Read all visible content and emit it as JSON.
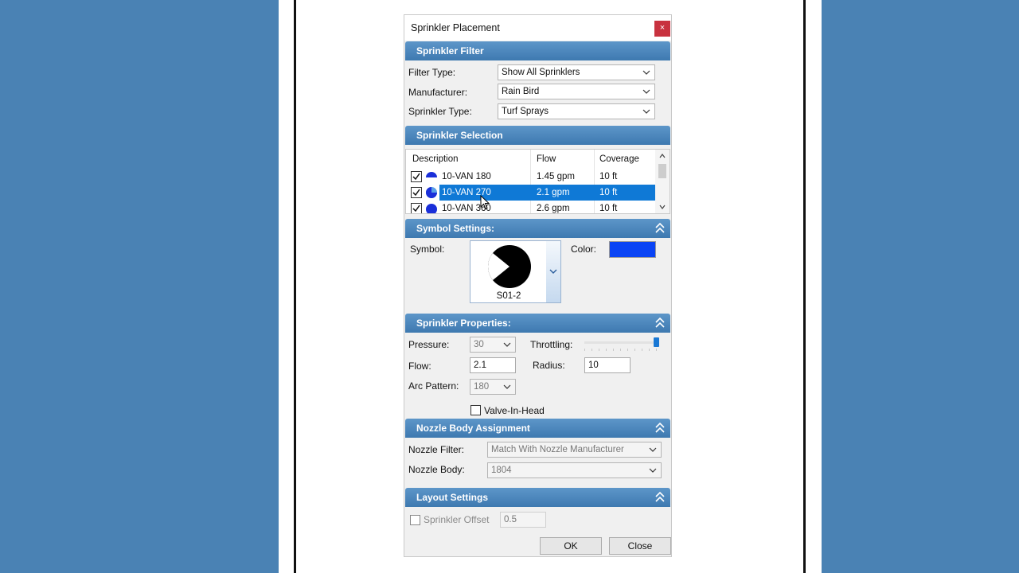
{
  "dialog": {
    "title": "Sprinkler Placement",
    "close_glyph": "×"
  },
  "filter_section": {
    "header": "Sprinkler Filter",
    "filter_type_label": "Filter Type:",
    "filter_type_value": "Show All Sprinklers",
    "manufacturer_label": "Manufacturer:",
    "manufacturer_value": "Rain Bird",
    "sprinkler_type_label": "Sprinkler Type:",
    "sprinkler_type_value": "Turf Sprays"
  },
  "selection_section": {
    "header": "Sprinkler Selection",
    "columns": [
      "Description",
      "Flow",
      "Coverage"
    ],
    "rows": [
      {
        "description": "10-VAN 180",
        "flow": "1.45 gpm",
        "coverage": "10 ft",
        "checked": true,
        "icon": "half-circle-icon",
        "selected": false
      },
      {
        "description": "10-VAN 270",
        "flow": "2.1 gpm",
        "coverage": "10 ft",
        "checked": true,
        "icon": "three-quarter-circle-icon",
        "selected": true
      },
      {
        "description": "10-VAN 360",
        "flow": "2.6 gpm",
        "coverage": "10 ft",
        "checked": true,
        "icon": "full-circle-icon",
        "selected": false
      }
    ]
  },
  "symbol_section": {
    "header": "Symbol Settings:",
    "symbol_label": "Symbol:",
    "symbol_name": "S01-2",
    "color_label": "Color:",
    "color_value": "#0a44f5"
  },
  "properties_section": {
    "header": "Sprinkler Properties:",
    "pressure_label": "Pressure:",
    "pressure_value": "30",
    "throttling_label": "Throttling:",
    "throttling_level": 1.0,
    "flow_label": "Flow:",
    "flow_value": "2.1",
    "radius_label": "Radius:",
    "radius_value": "10",
    "arc_label": "Arc Pattern:",
    "arc_value": "180",
    "valve_in_head_label": "Valve-In-Head",
    "valve_in_head_checked": false
  },
  "nozzle_section": {
    "header": "Nozzle Body Assignment",
    "nozzle_filter_label": "Nozzle Filter:",
    "nozzle_filter_value": "Match With Nozzle Manufacturer",
    "nozzle_body_label": "Nozzle Body:",
    "nozzle_body_value": "1804"
  },
  "layout_section": {
    "header": "Layout Settings",
    "offset_label": "Sprinkler Offset",
    "offset_value": "0.5",
    "offset_checked": false
  },
  "buttons": {
    "ok": "OK",
    "close": "Close"
  },
  "colors": {
    "background": "#4a82b4",
    "section_header": "#4a86bd",
    "selection": "#0f79d6",
    "close_button": "#c8323f",
    "symbol_color": "#0a44f5"
  }
}
